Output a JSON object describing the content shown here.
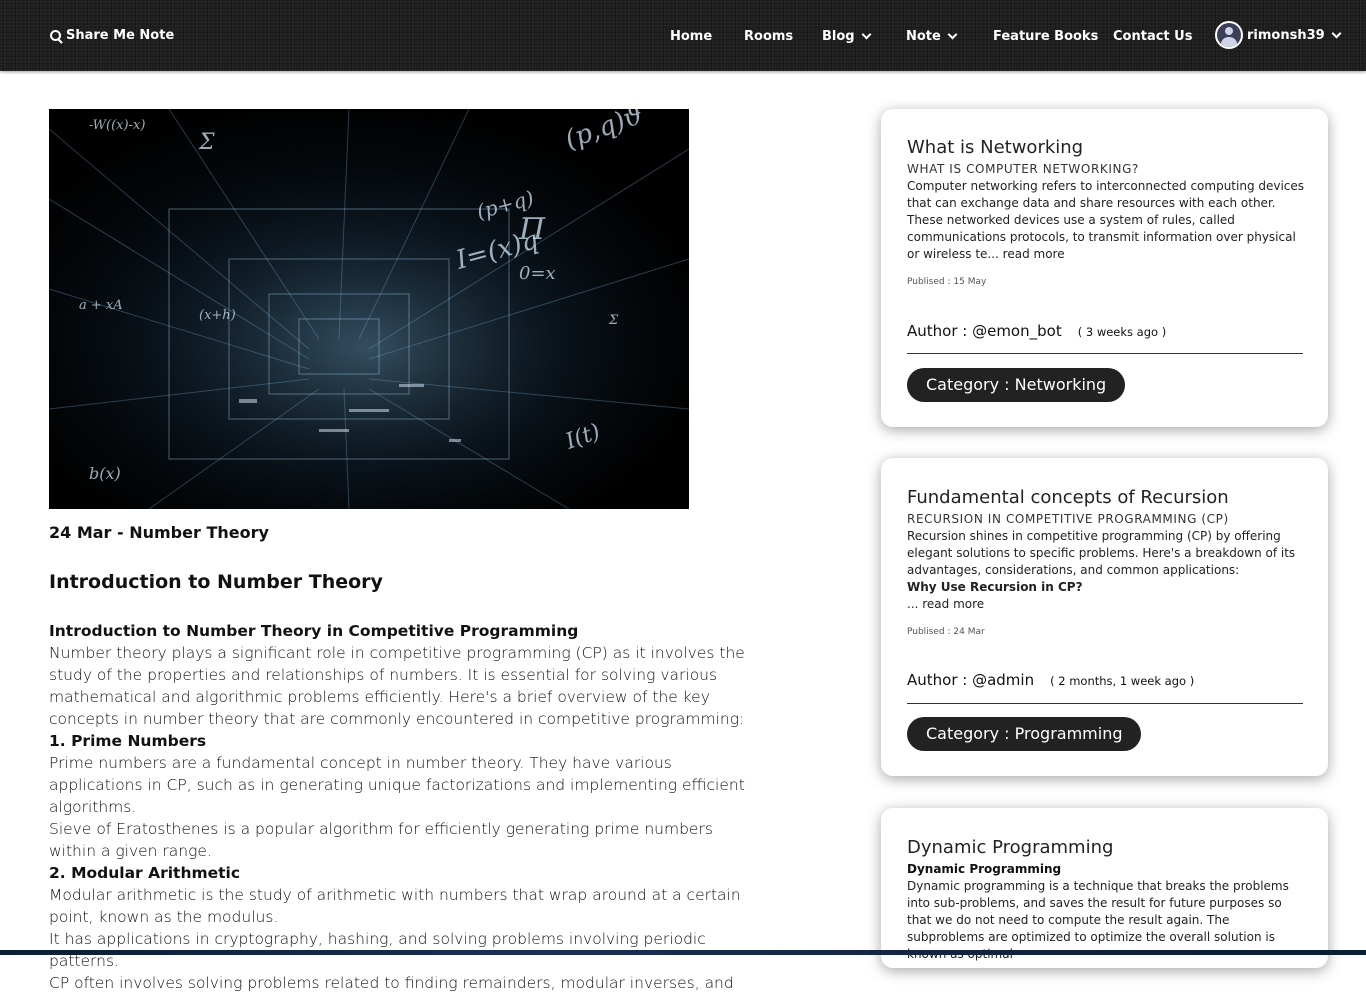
{
  "navbar": {
    "brand": "Share Me Note",
    "items": [
      {
        "label": "Home"
      },
      {
        "label": "Rooms"
      },
      {
        "label": "Blog"
      },
      {
        "label": "Note"
      },
      {
        "label": "Feature Books"
      },
      {
        "label": "Contact Us"
      }
    ],
    "username": "rimonsh39"
  },
  "post": {
    "date_line": "24 Mar - Number Theory",
    "title": "Introduction to Number Theory",
    "heading": "Introduction to Number Theory in Competitive Programming",
    "intro": "Number theory plays a significant role in competitive programming (CP) as it involves the study of the properties and relationships of numbers. It is essential for solving various mathematical and algorithmic problems efficiently. Here's a brief overview of the key concepts in number theory that are commonly encountered in competitive programming:",
    "section1_title": "1. Prime Numbers",
    "section1_p1": "Prime numbers are a fundamental concept in number theory. They have various applications in CP, such as in generating unique factorizations and implementing efficient algorithms.",
    "section1_p2": "Sieve of Eratosthenes is a popular algorithm for efficiently generating prime numbers within a given range.",
    "section2_title": "2. Modular Arithmetic",
    "section2_p1": "Modular arithmetic is the study of arithmetic with numbers that wrap around at a certain point, known as the modulus.",
    "section2_p2": "It has applications in cryptography, hashing, and solving problems involving periodic patterns.",
    "section2_p3": "CP often involves solving problems related to finding remainders, modular inverses, and"
  },
  "sidebar": {
    "cards": [
      {
        "title": "What is Networking",
        "subtitle": "WHAT IS COMPUTER NETWORKING?",
        "text": "Computer networking refers to interconnected computing devices that can exchange data and share resources with each other. These networked devices use a system of rules, called communications protocols, to transmit information over physical or wireless te... read more",
        "published": "Publised : 15 May",
        "author": "Author : @emon_bot",
        "ago": "( 3 weeks ago )",
        "category": "Category : Networking"
      },
      {
        "title": "Fundamental concepts of Recursion",
        "subtitle": "RECURSION IN COMPETITIVE PROGRAMMING (CP)",
        "text": "Recursion shines in competitive programming (CP) by offering elegant solutions to specific problems. Here's a breakdown of its advantages, considerations, and common applications:",
        "bold_line": "Why Use Recursion in CP?",
        "read_more": "... read more",
        "published": "Publised : 24 Mar",
        "author": "Author : @admin",
        "ago": "( 2 months, 1 week ago )",
        "category": "Category : Programming"
      },
      {
        "title": "Dynamic Programming",
        "subtitle": "Dynamic Programming",
        "text": "Dynamic programming is a technique that breaks the problems into sub-problems, and saves the result for future purposes so that we do not need to compute the result again. The subproblems are optimized to optimize the overall solution is known as optimal"
      }
    ]
  },
  "hero_image": {
    "description_icon": "math-formula-image",
    "glyphs": [
      "(p,q)ϑ",
      "Σ",
      "I=(x)q",
      "(p+q)",
      "b(x)",
      "Π",
      "0=x",
      "I(t)"
    ]
  },
  "colors": {
    "navbar_bg": "#1d1d1d",
    "category_bg": "#222222",
    "accent_white": "#ffffff"
  }
}
